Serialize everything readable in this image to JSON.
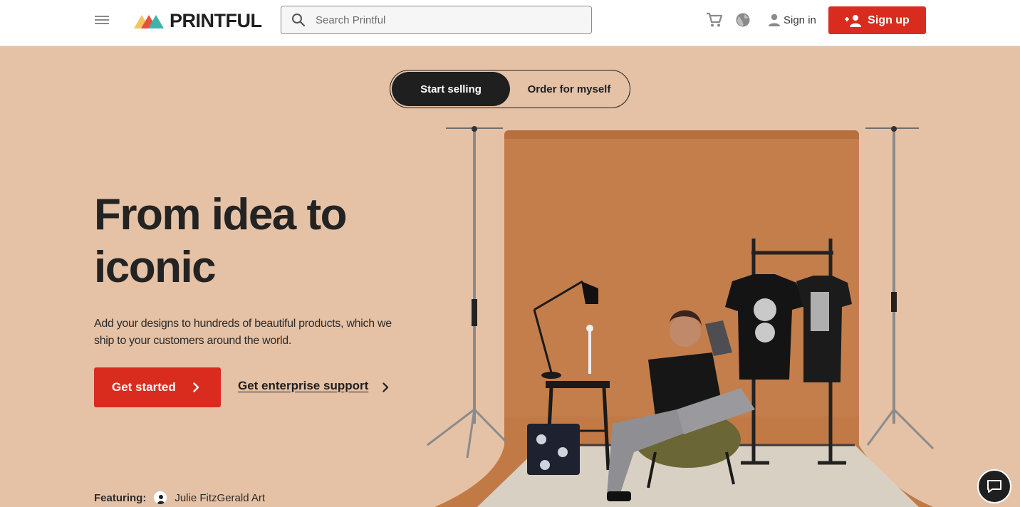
{
  "header": {
    "logo_text": "PRINTFUL",
    "search_placeholder": "Search Printful",
    "signin_label": "Sign in",
    "signup_label": "Sign up"
  },
  "hero": {
    "toggle": [
      "Start selling",
      "Order for myself"
    ],
    "headline_line1": "From idea to",
    "headline_line2": "iconic",
    "subtext": "Add your designs to hundreds of beautiful products, which we ship to your customers around the world.",
    "get_started_label": "Get started",
    "enterprise_label": "Get enterprise support",
    "featuring_label": "Featuring:",
    "featuring_name": "Julie FitzGerald Art"
  },
  "colors": {
    "accent": "#d92c1e",
    "hero_bg": "#e5c2a6",
    "dark": "#1f1f1f"
  },
  "icons": [
    "hamburger-menu-icon",
    "search-icon",
    "cart-icon",
    "globe-icon",
    "user-icon",
    "add-user-icon",
    "chevron-right-icon",
    "chat-icon"
  ]
}
